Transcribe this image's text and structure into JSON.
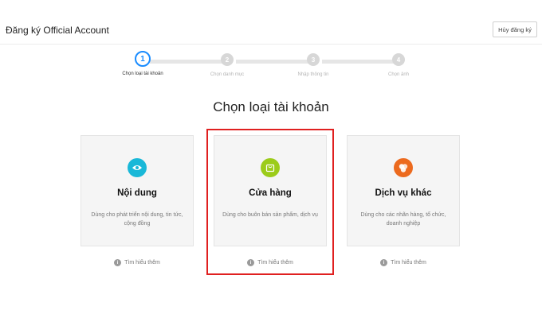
{
  "header": {
    "title": "Đăng ký Official Account",
    "cancel_label": "Hủy đăng ký"
  },
  "steps": [
    {
      "number": "1",
      "label": "Chọn loại tài khoản",
      "state": "active"
    },
    {
      "number": "2",
      "label": "Chọn danh mục",
      "state": "inactive"
    },
    {
      "number": "3",
      "label": "Nhập thông tin",
      "state": "inactive"
    },
    {
      "number": "4",
      "label": "Chọn ảnh",
      "state": "inactive"
    }
  ],
  "heading": "Chọn loại tài khoản",
  "cards": [
    {
      "icon": "eye-icon",
      "color": "#19b8d8",
      "title": "Nội dung",
      "desc": "Dùng cho phát triển nội dung, tin tức, cộng đồng",
      "learn_more": "Tìm hiểu thêm"
    },
    {
      "icon": "shopping-bag-icon",
      "color": "#9ccc1a",
      "title": "Cửa hàng",
      "desc": "Dùng cho buôn bán sản phẩm, dịch vụ",
      "learn_more": "Tìm hiểu thêm"
    },
    {
      "icon": "circles-icon",
      "color": "#ec6a1e",
      "title": "Dịch vụ khác",
      "desc": "Dùng cho các nhãn hàng, tổ chức, doanh nghiệp",
      "learn_more": "Tìm hiểu thêm"
    }
  ],
  "colors": {
    "accent": "#1a8cff",
    "highlight": "#e02020"
  }
}
